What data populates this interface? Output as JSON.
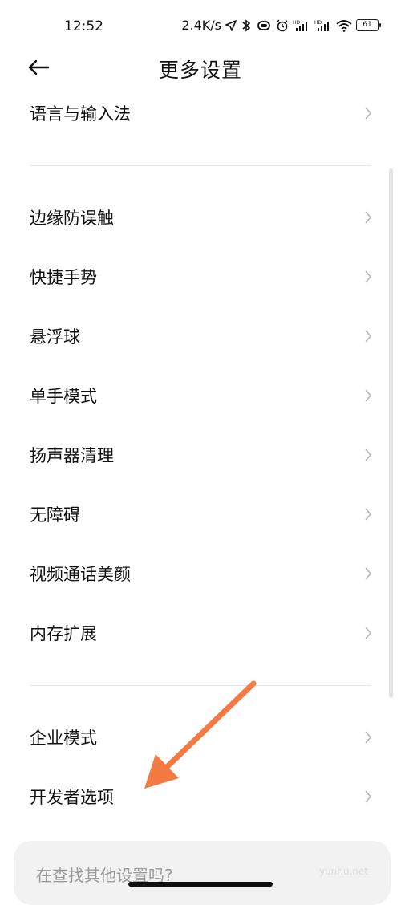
{
  "status_bar": {
    "time": "12:52",
    "net_speed": "2.4K/s",
    "battery": "61",
    "icons": [
      "location-icon",
      "bluetooth-icon",
      "vibrate-icon",
      "alarm-icon",
      "hd-signal-icon",
      "hd-signal-icon",
      "wifi-icon",
      "battery-icon"
    ]
  },
  "header": {
    "back_icon": "arrow-left-icon",
    "title": "更多设置"
  },
  "list": {
    "items": [
      {
        "label": "语言与输入法",
        "group": 1
      },
      {
        "label": "边缘防误触",
        "group": 2
      },
      {
        "label": "快捷手势",
        "group": 2
      },
      {
        "label": "悬浮球",
        "group": 2
      },
      {
        "label": "单手模式",
        "group": 2
      },
      {
        "label": "扬声器清理",
        "group": 2
      },
      {
        "label": "无障碍",
        "group": 2
      },
      {
        "label": "视频通话美颜",
        "group": 2
      },
      {
        "label": "内存扩展",
        "group": 2
      },
      {
        "label": "企业模式",
        "group": 3
      },
      {
        "label": "开发者选项",
        "group": 3
      }
    ],
    "chevron_icon": "chevron-right-icon"
  },
  "search": {
    "placeholder": "在查找其他设置吗?"
  },
  "watermark": "yunhu.net",
  "annotation": {
    "icon": "orange-arrow-icon",
    "color": "#F47A43",
    "points_to": "开发者选项"
  }
}
